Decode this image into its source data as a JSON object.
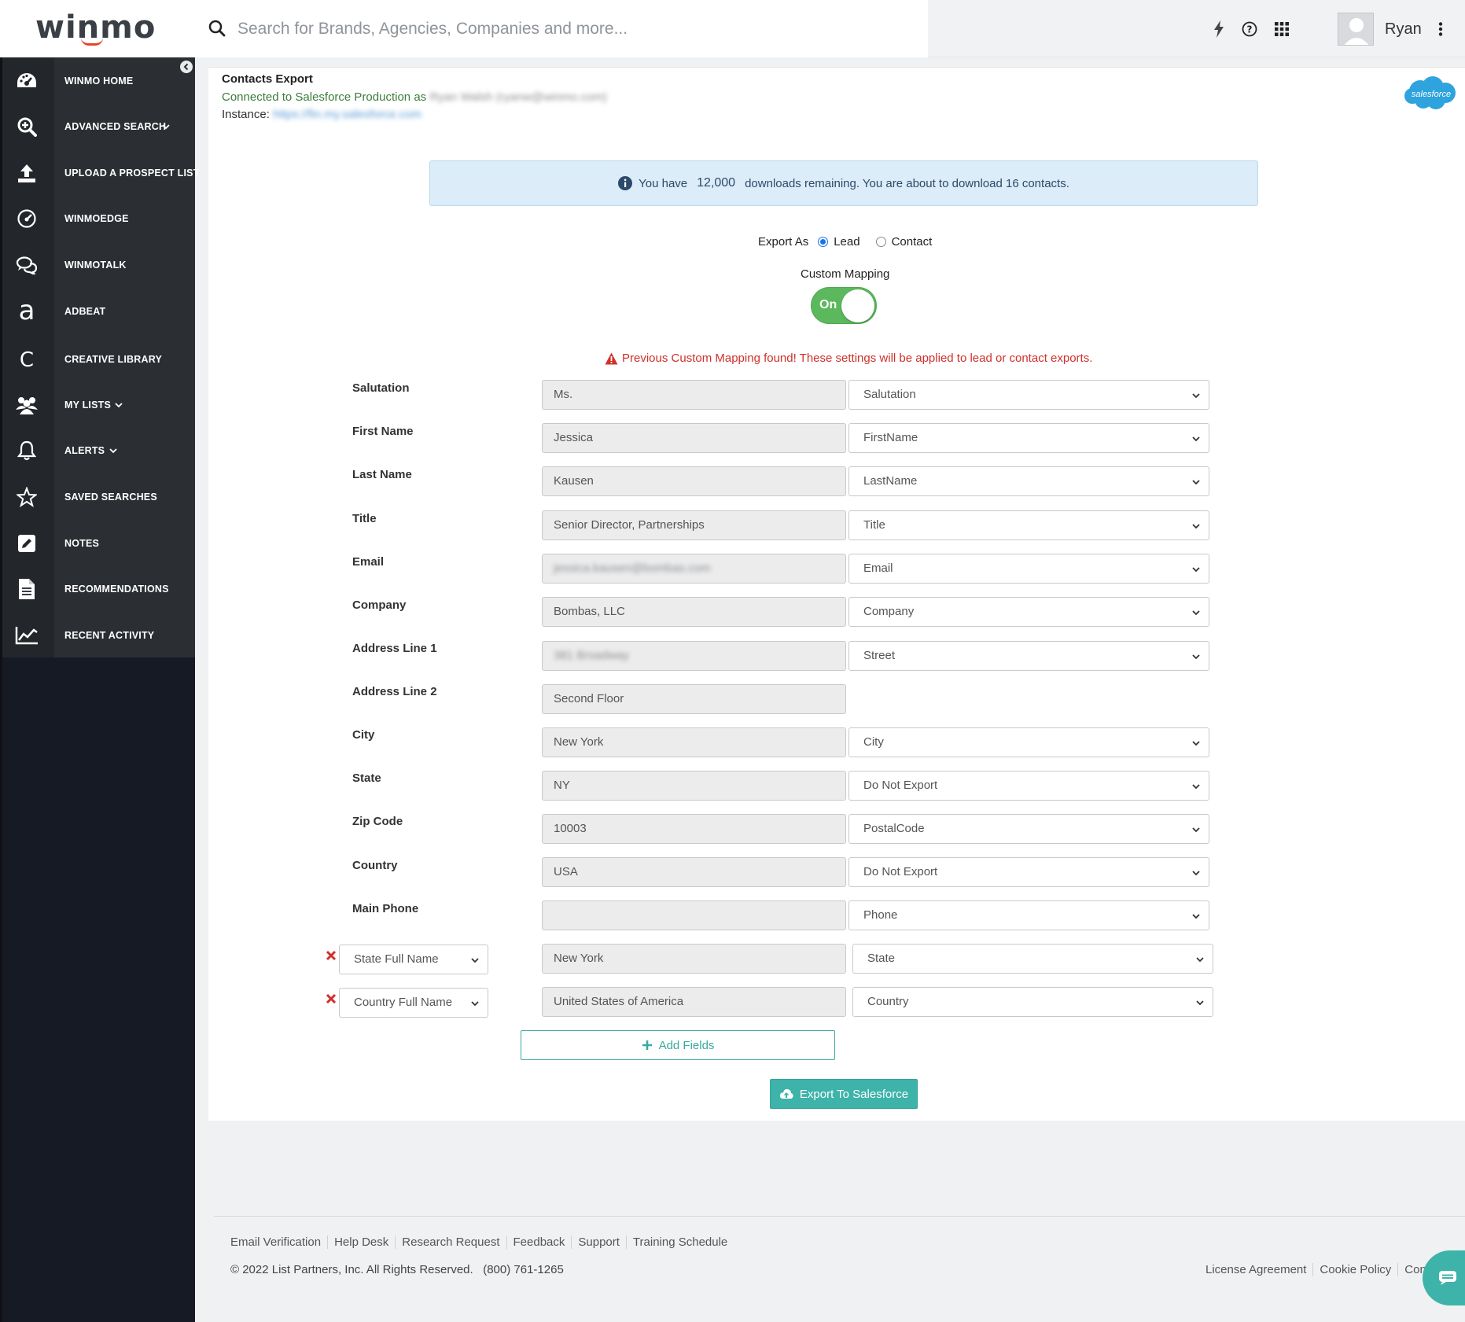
{
  "header": {
    "logo_text": "winmo",
    "search_placeholder": "Search for Brands, Agencies, Companies and more...",
    "user_name": "Ryan"
  },
  "sidebar": {
    "items": [
      {
        "label": "WINMO HOME",
        "icon": "dashboard-icon"
      },
      {
        "label": "ADVANCED SEARCH",
        "icon": "zoom-search-icon",
        "has_chevron": true
      },
      {
        "label": "UPLOAD A PROSPECT LIST",
        "icon": "upload-icon"
      },
      {
        "label": "WINMOEDGE",
        "icon": "gauge-icon"
      },
      {
        "label": "WINMOTALK",
        "icon": "chat-bubbles-icon"
      },
      {
        "label": "ADBEAT",
        "icon": "adbeat-a-icon"
      },
      {
        "label": "CREATIVE LIBRARY",
        "icon": "creative-c-icon"
      },
      {
        "label": "MY LISTS",
        "icon": "users-icon",
        "has_chevron": true
      },
      {
        "label": "ALERTS",
        "icon": "bell-icon",
        "has_chevron": true
      },
      {
        "label": "SAVED SEARCHES",
        "icon": "star-icon"
      },
      {
        "label": "NOTES",
        "icon": "pencil-square-icon"
      },
      {
        "label": "RECOMMENDATIONS",
        "icon": "document-icon"
      },
      {
        "label": "RECENT ACTIVITY",
        "icon": "line-chart-icon"
      }
    ]
  },
  "export": {
    "title": "Contacts Export",
    "connected_prefix": "Connected to Salesforce Production as",
    "connected_user": "Ryan Walsh (ryanw@winmo.com)",
    "instance_label": "Instance:",
    "instance_url": "https://fin.my.salesforce.com",
    "salesforce_logo_text": "salesforce",
    "banner_prefix": "You have",
    "banner_count": "12,000",
    "banner_suffix": "downloads remaining. You are about to download 16 contacts.",
    "export_as_label": "Export As",
    "option_lead": "Lead",
    "option_contact": "Contact",
    "selected_option": "Lead",
    "custom_mapping_label": "Custom Mapping",
    "toggle_label": "On",
    "warning_text": "Previous Custom Mapping found! These settings will be applied to lead or contact exports.",
    "add_fields_label": "Add Fields",
    "export_button_label": "Export To Salesforce"
  },
  "mapping_rows": [
    {
      "label": "Salutation",
      "value": "Ms.",
      "target": "Salutation"
    },
    {
      "label": "First Name",
      "value": "Jessica",
      "target": "FirstName"
    },
    {
      "label": "Last Name",
      "value": "Kausen",
      "target": "LastName"
    },
    {
      "label": "Title",
      "value": "Senior Director, Partnerships",
      "target": "Title"
    },
    {
      "label": "Email",
      "value": "jessica.kausen@bombas.com",
      "target": "Email",
      "blurred": true
    },
    {
      "label": "Company",
      "value": "Bombas, LLC",
      "target": "Company"
    },
    {
      "label": "Address Line 1",
      "value": "381 Broadway",
      "target": "Street",
      "blurred": true
    },
    {
      "label": "Address Line 2",
      "value": "Second Floor",
      "target": ""
    },
    {
      "label": "City",
      "value": "New York",
      "target": "City"
    },
    {
      "label": "State",
      "value": "NY",
      "target": "Do Not Export"
    },
    {
      "label": "Zip Code",
      "value": "10003",
      "target": "PostalCode"
    },
    {
      "label": "Country",
      "value": "USA",
      "target": "Do Not Export"
    },
    {
      "label": "Main Phone",
      "value": "",
      "target": "Phone"
    }
  ],
  "custom_rows": [
    {
      "field": "State Full Name",
      "value": "New York",
      "target": "State"
    },
    {
      "field": "Country Full Name",
      "value": "United States of America",
      "target": "Country"
    }
  ],
  "footer": {
    "links": [
      "Email Verification",
      "Help Desk",
      "Research Request",
      "Feedback",
      "Support",
      "Training Schedule"
    ],
    "copyright": "© 2022 List Partners, Inc. All Rights Reserved.",
    "phone": "(800) 761-1265",
    "right_links": [
      "License Agreement",
      "Cookie Policy",
      "Cont"
    ]
  },
  "colors": {
    "sidebar_bg": "#2b2e33",
    "accent_teal": "#3db3aa",
    "toggle_green": "#5cb85c",
    "warning_red": "#d0302b",
    "connected_green": "#3a7d3a",
    "banner_bg": "#dcecf8"
  }
}
